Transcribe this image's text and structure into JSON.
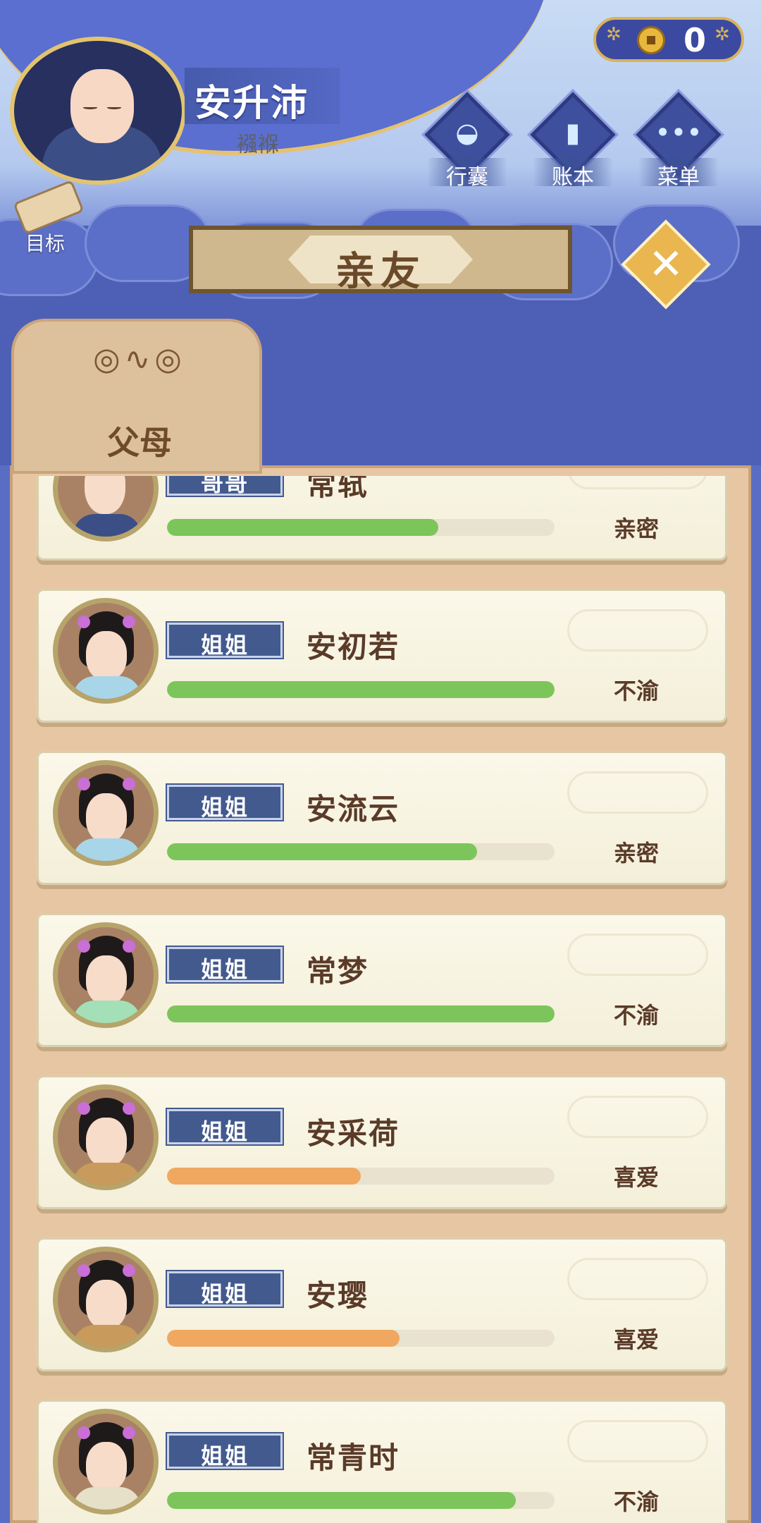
{
  "header": {
    "player_name": "安升沛",
    "player_title": "襁褓",
    "goal_label": "目标",
    "coins": "0"
  },
  "menu": [
    {
      "label": "行囊",
      "icon": "bag-icon"
    },
    {
      "label": "账本",
      "icon": "ledger-icon"
    },
    {
      "label": "菜单",
      "icon": "more-icon"
    }
  ],
  "title": "亲友",
  "tab": {
    "label": "父母"
  },
  "members": [
    {
      "relation": "哥哥",
      "name": "常轼",
      "status": "亲密",
      "progress": 0.7,
      "color": "#7cc55a",
      "robe": "#3b4f86",
      "bald": true
    },
    {
      "relation": "姐姐",
      "name": "安初若",
      "status": "不渝",
      "progress": 1.0,
      "color": "#7cc55a",
      "robe": "#a8d6e8",
      "bald": false
    },
    {
      "relation": "姐姐",
      "name": "安流云",
      "status": "亲密",
      "progress": 0.8,
      "color": "#7cc55a",
      "robe": "#a8d6e8",
      "bald": false
    },
    {
      "relation": "姐姐",
      "name": "常梦",
      "status": "不渝",
      "progress": 1.0,
      "color": "#7cc55a",
      "robe": "#a3e0b8",
      "bald": false
    },
    {
      "relation": "姐姐",
      "name": "安采荷",
      "status": "喜爱",
      "progress": 0.5,
      "color": "#f0a860",
      "robe": "#c89a5c",
      "bald": false
    },
    {
      "relation": "姐姐",
      "name": "安璎",
      "status": "喜爱",
      "progress": 0.6,
      "color": "#f0a860",
      "robe": "#c89a5c",
      "bald": false
    },
    {
      "relation": "姐姐",
      "name": "常青时",
      "status": "不渝",
      "progress": 0.9,
      "color": "#7cc55a",
      "robe": "#e6e0c8",
      "bald": false
    }
  ]
}
